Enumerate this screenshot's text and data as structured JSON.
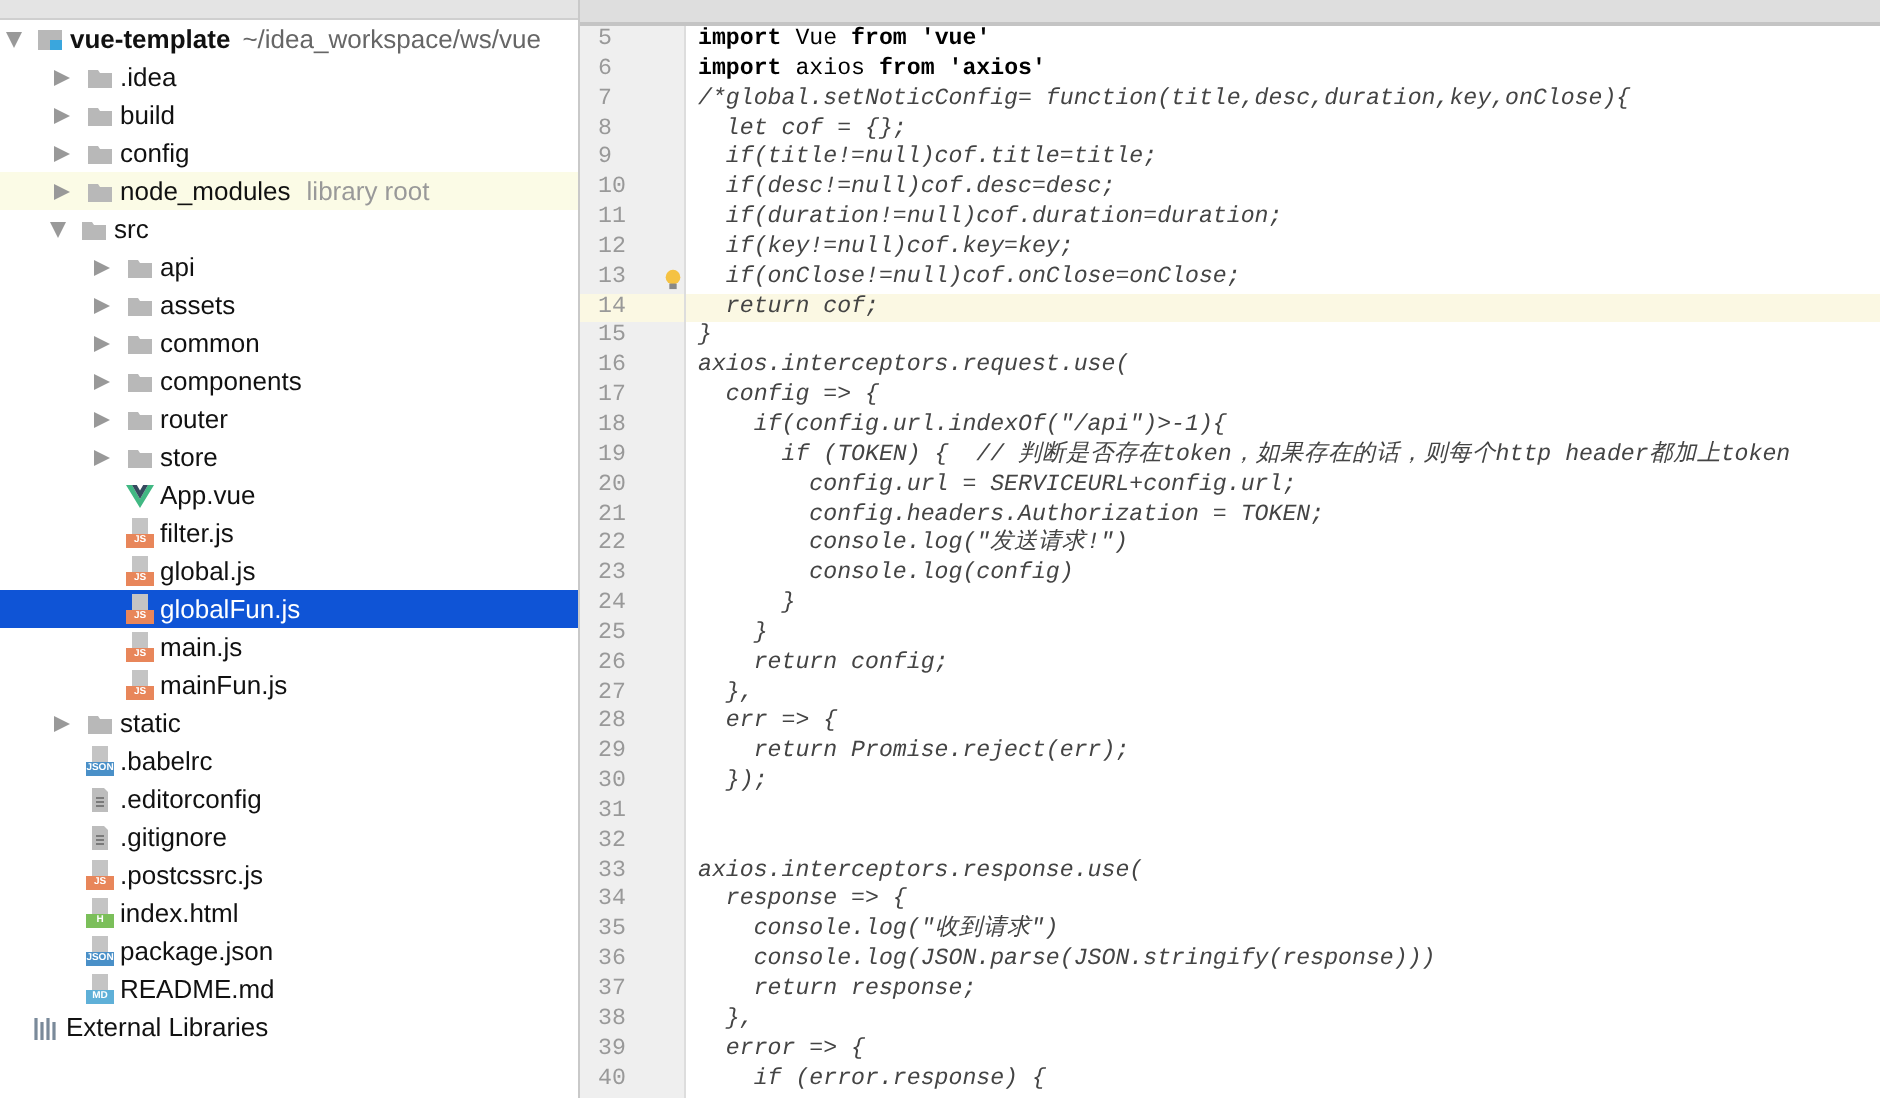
{
  "project_tree": {
    "root": {
      "name": "vue-template",
      "path": "~/idea_workspace/ws/vue",
      "expanded": true,
      "children": [
        {
          "name": ".idea",
          "kind": "folder",
          "expanded": false,
          "selected": false
        },
        {
          "name": "build",
          "kind": "folder",
          "expanded": false,
          "selected": false
        },
        {
          "name": "config",
          "kind": "folder",
          "expanded": false,
          "selected": false
        },
        {
          "name": "node_modules",
          "kind": "folder",
          "expanded": false,
          "selected": false,
          "note": "library root"
        },
        {
          "name": "src",
          "kind": "folder",
          "expanded": true,
          "selected": false,
          "children": [
            {
              "name": "api",
              "kind": "folder",
              "expanded": false,
              "selected": false
            },
            {
              "name": "assets",
              "kind": "folder",
              "expanded": false,
              "selected": false
            },
            {
              "name": "common",
              "kind": "folder",
              "expanded": false,
              "selected": false
            },
            {
              "name": "components",
              "kind": "folder",
              "expanded": false,
              "selected": false
            },
            {
              "name": "router",
              "kind": "folder",
              "expanded": false,
              "selected": false
            },
            {
              "name": "store",
              "kind": "folder",
              "expanded": false,
              "selected": false
            },
            {
              "name": "App.vue",
              "kind": "vue",
              "selected": false
            },
            {
              "name": "filter.js",
              "kind": "file",
              "badge": "JS",
              "selected": false
            },
            {
              "name": "global.js",
              "kind": "file",
              "badge": "JS",
              "selected": false
            },
            {
              "name": "globalFun.js",
              "kind": "file",
              "badge": "JS",
              "selected": true
            },
            {
              "name": "main.js",
              "kind": "file",
              "badge": "JS",
              "selected": false
            },
            {
              "name": "mainFun.js",
              "kind": "file",
              "badge": "JS",
              "selected": false
            }
          ]
        },
        {
          "name": "static",
          "kind": "folder",
          "expanded": false,
          "selected": false
        },
        {
          "name": ".babelrc",
          "kind": "file",
          "badge": "JSON",
          "selected": false
        },
        {
          "name": ".editorconfig",
          "kind": "text",
          "selected": false
        },
        {
          "name": ".gitignore",
          "kind": "text",
          "selected": false
        },
        {
          "name": ".postcssrc.js",
          "kind": "file",
          "badge": "JS",
          "selected": false
        },
        {
          "name": "index.html",
          "kind": "file",
          "badge": "H",
          "selected": false
        },
        {
          "name": "package.json",
          "kind": "file",
          "badge": "JSON",
          "selected": false
        },
        {
          "name": "README.md",
          "kind": "file",
          "badge": "MD",
          "selected": false
        }
      ]
    },
    "external": {
      "name": "External Libraries"
    }
  },
  "editor": {
    "lines": [
      {
        "number": "5",
        "kind": "code",
        "text": "**import** Vue **from** **'vue'**"
      },
      {
        "number": "6",
        "kind": "code",
        "text": "**import** axios **from** **'axios'**"
      },
      {
        "number": "7",
        "kind": "comment",
        "text": "/*global.setNoticConfig= function(title,desc,duration,key,onClose){"
      },
      {
        "number": "8",
        "kind": "comment",
        "text": "  let cof = {};"
      },
      {
        "number": "9",
        "kind": "comment",
        "text": "  if(title!=null)cof.title=title;"
      },
      {
        "number": "10",
        "kind": "comment",
        "text": "  if(desc!=null)cof.desc=desc;"
      },
      {
        "number": "11",
        "kind": "comment",
        "text": "  if(duration!=null)cof.duration=duration;"
      },
      {
        "number": "12",
        "kind": "comment",
        "text": "  if(key!=null)cof.key=key;"
      },
      {
        "number": "13",
        "kind": "comment",
        "text": "  if(onClose!=null)cof.onClose=onClose;",
        "bulb": true
      },
      {
        "number": "14",
        "kind": "comment",
        "text": "  return cof;",
        "current": true
      },
      {
        "number": "15",
        "kind": "comment",
        "text": "}"
      },
      {
        "number": "16",
        "kind": "comment",
        "text": "axios.interceptors.request.use("
      },
      {
        "number": "17",
        "kind": "comment",
        "text": "  config => {"
      },
      {
        "number": "18",
        "kind": "comment",
        "text": "    if(config.url.indexOf(\"/api\")>-1){"
      },
      {
        "number": "19",
        "kind": "comment",
        "text": "      if (TOKEN) {  // 判断是否存在token，如果存在的话，则每个http header都加上token"
      },
      {
        "number": "20",
        "kind": "comment",
        "text": "        config.url = SERVICEURL+config.url;"
      },
      {
        "number": "21",
        "kind": "comment",
        "text": "        config.headers.Authorization = TOKEN;"
      },
      {
        "number": "22",
        "kind": "comment",
        "text": "        console.log(\"发送请求!\")"
      },
      {
        "number": "23",
        "kind": "comment",
        "text": "        console.log(config)"
      },
      {
        "number": "24",
        "kind": "comment",
        "text": "      }"
      },
      {
        "number": "25",
        "kind": "comment",
        "text": "    }"
      },
      {
        "number": "26",
        "kind": "comment",
        "text": "    return config;"
      },
      {
        "number": "27",
        "kind": "comment",
        "text": "  },"
      },
      {
        "number": "28",
        "kind": "comment",
        "text": "  err => {"
      },
      {
        "number": "29",
        "kind": "comment",
        "text": "    return Promise.reject(err);"
      },
      {
        "number": "30",
        "kind": "comment",
        "text": "  });"
      },
      {
        "number": "31",
        "kind": "comment"
      },
      {
        "number": "32",
        "kind": "comment"
      },
      {
        "number": "33",
        "kind": "comment",
        "text": "axios.interceptors.response.use("
      },
      {
        "number": "34",
        "kind": "comment",
        "text": "  response => {"
      },
      {
        "number": "35",
        "kind": "comment",
        "text": "    console.log(\"收到请求\")"
      },
      {
        "number": "36",
        "kind": "comment",
        "text": "    console.log(JSON.parse(JSON.stringify(response)))"
      },
      {
        "number": "37",
        "kind": "comment",
        "text": "    return response;"
      },
      {
        "number": "38",
        "kind": "comment",
        "text": "  },"
      },
      {
        "number": "39",
        "kind": "comment",
        "text": "  error => {"
      },
      {
        "number": "40",
        "kind": "comment",
        "text": "    if (error.response) {"
      }
    ]
  }
}
